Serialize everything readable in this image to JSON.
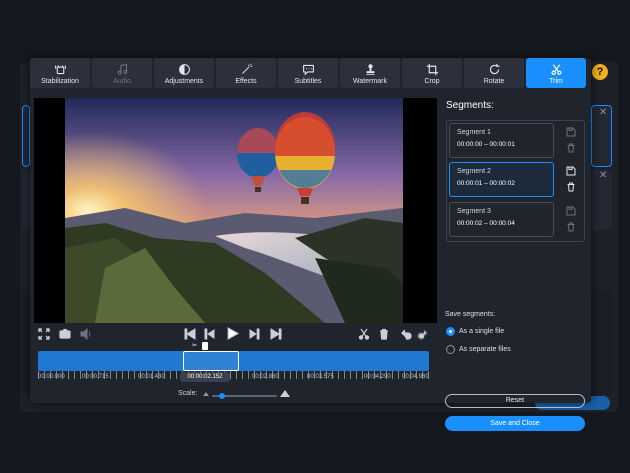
{
  "toolbar": {
    "tabs": [
      {
        "label": "Stabilization",
        "icon": "stabilization-icon"
      },
      {
        "label": "Audio",
        "icon": "music-note-icon"
      },
      {
        "label": "Adjustments",
        "icon": "adjustments-icon"
      },
      {
        "label": "Effects",
        "icon": "magic-wand-icon"
      },
      {
        "label": "Subtitles",
        "icon": "speech-bubble-icon"
      },
      {
        "label": "Watermark",
        "icon": "stamp-icon"
      },
      {
        "label": "Crop",
        "icon": "crop-icon"
      },
      {
        "label": "Rotate",
        "icon": "rotate-icon"
      },
      {
        "label": "Trim",
        "icon": "scissors-icon"
      }
    ],
    "active": "Trim",
    "disabled": [
      "Audio"
    ]
  },
  "timeline": {
    "current_time": "00:00:02.152",
    "ticks": [
      "00:00.000",
      "00:00.715",
      "00:01.430",
      "00:02.860",
      "00:03.575",
      "00:04.290",
      "00:04.960"
    ],
    "selection": {
      "start_fraction": 0.37,
      "end_fraction": 0.515
    },
    "scale_label": "Scale:",
    "scale_level": 0.1
  },
  "segments": {
    "heading": "Segments:",
    "items": [
      {
        "name": "Segment 1",
        "range": "00:00:00 – 00:00:01",
        "selected": false
      },
      {
        "name": "Segment 2",
        "range": "00:00:01 – 00:00:02",
        "selected": true
      },
      {
        "name": "Segment 3",
        "range": "00:00:02 – 00:00:04",
        "selected": false
      }
    ]
  },
  "save_segments": {
    "heading": "Save segments:",
    "options": [
      {
        "label": "As a single file",
        "selected": true
      },
      {
        "label": "As separate files",
        "selected": false
      }
    ]
  },
  "buttons": {
    "reset": "Reset",
    "save_close": "Save and Close"
  },
  "background": {
    "help_glyph": "?"
  },
  "colors": {
    "accent": "#1a8fff",
    "panel": "#20242d",
    "timeline": "#1f78d1"
  }
}
